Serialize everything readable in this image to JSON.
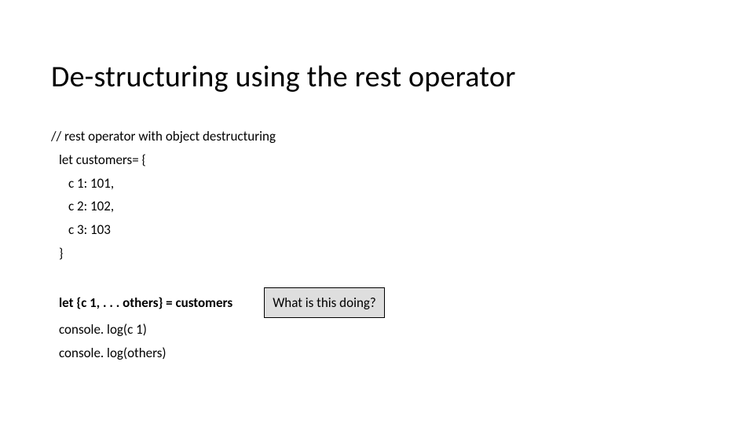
{
  "title": "De-structuring using the rest operator",
  "code": {
    "l1": "// rest operator with object destructuring",
    "l2": "let customers= {",
    "l3": "c 1: 101,",
    "l4": "c 2: 102,",
    "l5": "c 3: 103",
    "l6": "}",
    "l7": "let {c 1, . . . others} = customers",
    "l8": "console. log(c 1)",
    "l9": "console. log(others)"
  },
  "callout": "What is this doing?"
}
